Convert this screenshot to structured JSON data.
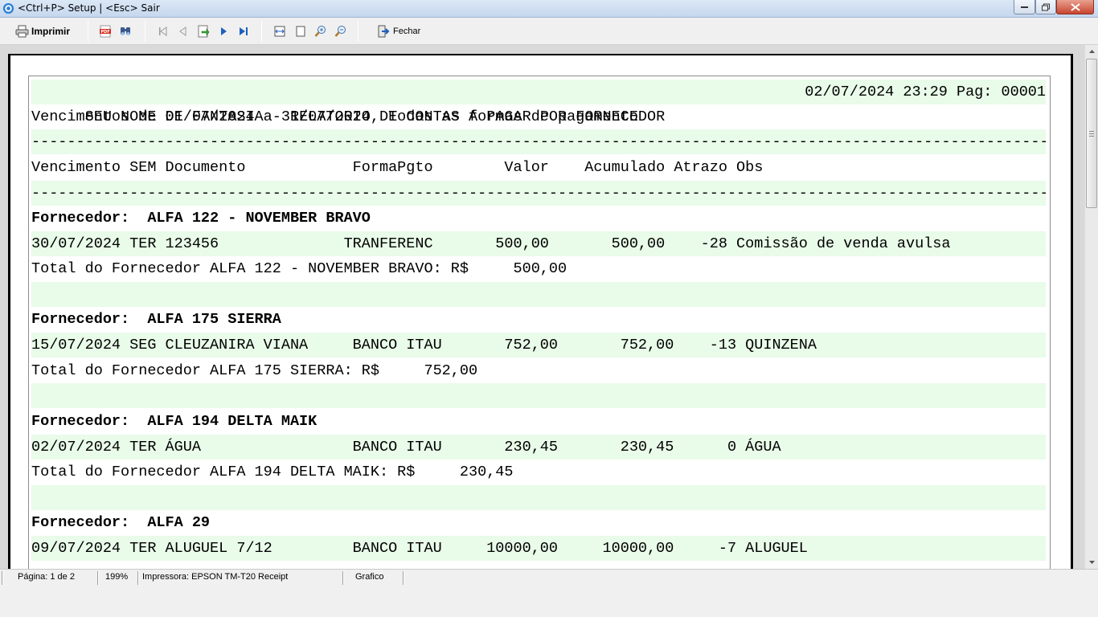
{
  "window": {
    "title": "<Ctrl+P> Setup | <Esc> Sair"
  },
  "toolbar": {
    "print_label": "Imprimir",
    "close_label": "Fechar"
  },
  "report": {
    "header_left": "SEU NOME DE FANTASIA - RELATORIO DE CONTAS A PAGAR POR FORNECEDOR",
    "header_right": "02/07/2024 23:29 Pag: 00001",
    "subtitle": "Vencimentos de 01/07/2024 a 31/07/2024, Todas as formas de pagamento",
    "separator": "-----------------------------------------------------------------------------------------------------------------------------",
    "columns": "Vencimento SEM Documento            FormaPgto        Valor    Acumulado Atrazo Obs",
    "groups": [
      {
        "supplier_label": "Fornecedor:  ALFA 122 - NOVEMBER BRAVO",
        "line": "30/07/2024 TER 123456              TRANFERENC       500,00       500,00    -28 Comissão de venda avulsa",
        "total": "Total do Fornecedor ALFA 122 - NOVEMBER BRAVO: R$     500,00"
      },
      {
        "supplier_label": "Fornecedor:  ALFA 175 SIERRA",
        "line": "15/07/2024 SEG CLEUZANIRA VIANA     BANCO ITAU       752,00       752,00    -13 QUINZENA",
        "total": "Total do Fornecedor ALFA 175 SIERRA: R$     752,00"
      },
      {
        "supplier_label": "Fornecedor:  ALFA 194 DELTA MAIK",
        "line": "02/07/2024 TER ÁGUA                 BANCO ITAU       230,45       230,45      0 ÁGUA",
        "total": "Total do Fornecedor ALFA 194 DELTA MAIK: R$     230,45"
      },
      {
        "supplier_label": "Fornecedor:  ALFA 29",
        "line": "09/07/2024 TER ALUGUEL 7/12         BANCO ITAU     10000,00     10000,00     -7 ALUGUEL"
      }
    ]
  },
  "status": {
    "page": "Página: 1 de 2",
    "zoom": "199%",
    "printer": "Impressora: EPSON TM-T20 Receipt",
    "mode": "Grafico"
  }
}
